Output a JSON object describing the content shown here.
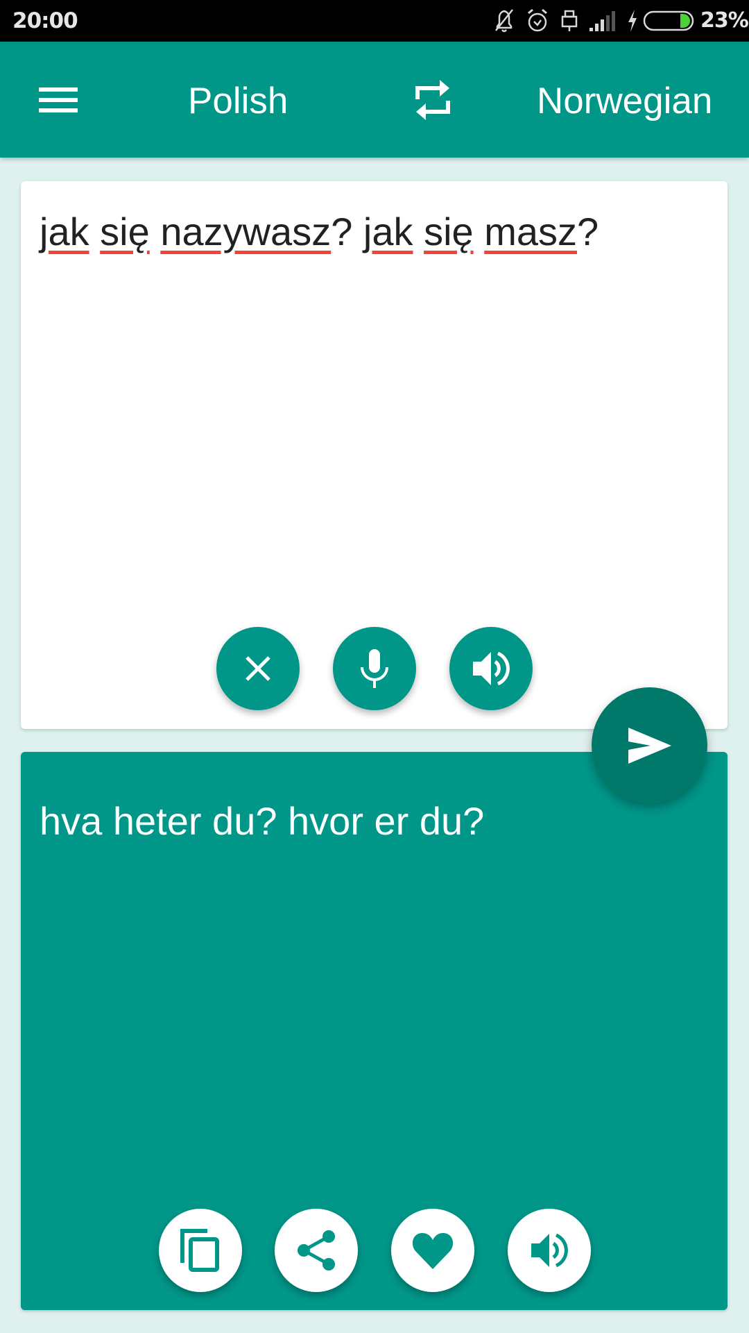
{
  "status_bar": {
    "time": "20:00",
    "battery_percent": "23%",
    "battery_level": 0.23,
    "icons": [
      "notifications-off-icon",
      "alarm-icon",
      "usb-icon",
      "signal-icon",
      "charging-bolt-icon",
      "battery-icon"
    ]
  },
  "toolbar": {
    "menu_icon": "hamburger-menu-icon",
    "source_language": "Polish",
    "swap_icon": "swap-languages-icon",
    "target_language": "Norwegian"
  },
  "input": {
    "words": [
      "jak",
      "się",
      "nazywasz",
      "?",
      "jak",
      "się",
      "masz",
      "?"
    ],
    "text": "jak się nazywasz? jak się masz?",
    "buttons": [
      {
        "name": "clear",
        "icon": "close-icon"
      },
      {
        "name": "microphone",
        "icon": "microphone-icon"
      },
      {
        "name": "speak-source",
        "icon": "speaker-icon"
      }
    ]
  },
  "send_button": {
    "icon": "send-icon"
  },
  "output": {
    "text": "hva heter du? hvor er du?",
    "buttons": [
      {
        "name": "copy",
        "icon": "copy-icon"
      },
      {
        "name": "share",
        "icon": "share-icon"
      },
      {
        "name": "favorite",
        "icon": "heart-icon"
      },
      {
        "name": "speak-target",
        "icon": "speaker-icon"
      }
    ]
  },
  "colors": {
    "primary": "#009688",
    "primary_dark": "#00796b",
    "background": "#dff1ee",
    "spellcheck_underline": "#f44336",
    "battery_fill": "#4cd137"
  }
}
